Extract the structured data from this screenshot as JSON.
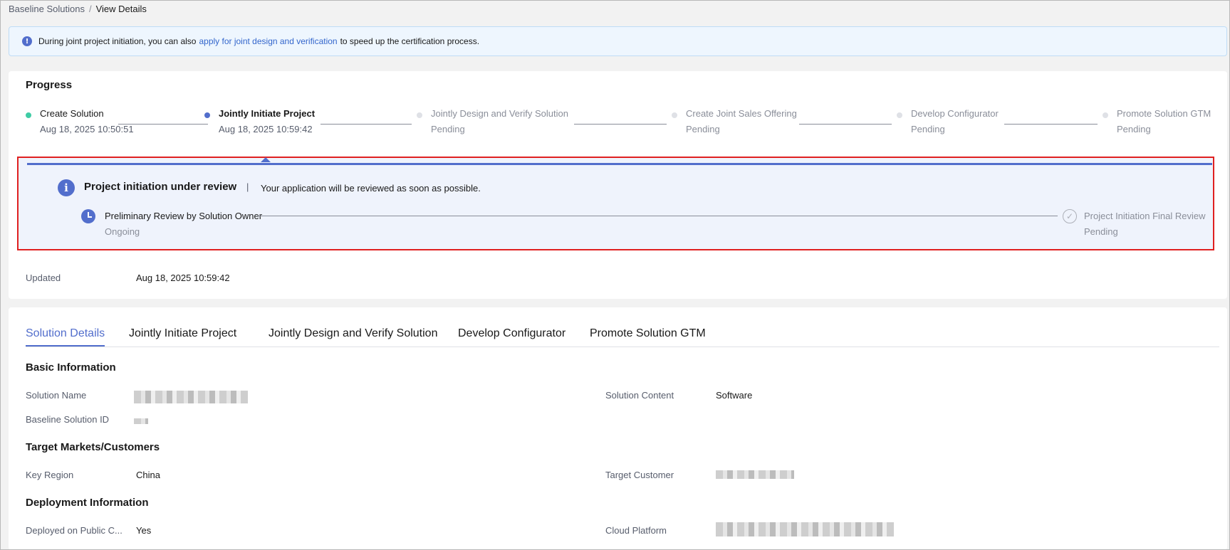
{
  "breadcrumb": {
    "parent": "Baseline Solutions",
    "separator": "/",
    "current": "View Details"
  },
  "notice": {
    "before": "During joint project initiation, you can also",
    "link": "apply for joint design and verification",
    "after": "to speed up the certification process."
  },
  "progress": {
    "title": "Progress",
    "steps": [
      {
        "label": "Create Solution",
        "sub": "Aug 18, 2025 10:50:51",
        "status": "done"
      },
      {
        "label": "Jointly Initiate Project",
        "sub": "Aug 18, 2025 10:59:42",
        "status": "active"
      },
      {
        "label": "Jointly Design and Verify Solution",
        "sub": "Pending",
        "status": "pending"
      },
      {
        "label": "Create Joint Sales Offering",
        "sub": "Pending",
        "status": "pending"
      },
      {
        "label": "Develop Configurator",
        "sub": "Pending",
        "status": "pending"
      },
      {
        "label": "Promote Solution GTM",
        "sub": "Pending",
        "status": "pending"
      }
    ],
    "review": {
      "title": "Project initiation under review",
      "separator": "|",
      "message": "Your application will be reviewed as soon as possible.",
      "sub_steps": [
        {
          "label": "Preliminary Review by Solution Owner",
          "status": "Ongoing"
        },
        {
          "label": "Project Initiation Final Review",
          "status": "Pending"
        }
      ]
    },
    "updated_label": "Updated",
    "updated_value": "Aug 18, 2025 10:59:42"
  },
  "tabs": [
    {
      "label": "Solution Details"
    },
    {
      "label": "Jointly Initiate Project"
    },
    {
      "label": "Jointly Design and Verify Solution"
    },
    {
      "label": "Develop Configurator"
    },
    {
      "label": "Promote Solution GTM"
    }
  ],
  "basic_info": {
    "title": "Basic Information",
    "solution_name_label": "Solution Name",
    "solution_content_label": "Solution Content",
    "solution_content_value": "Software",
    "baseline_id_label": "Baseline Solution ID"
  },
  "target": {
    "title": "Target Markets/Customers",
    "key_region_label": "Key Region",
    "key_region_value": "China",
    "target_customer_label": "Target Customer"
  },
  "deployment": {
    "title": "Deployment Information",
    "public_cloud_label": "Deployed on Public C...",
    "public_cloud_value": "Yes",
    "cloud_platform_label": "Cloud Platform"
  },
  "colors": {
    "accent": "#526ecc",
    "done": "#3fcca5",
    "pending": "#dfe1e6",
    "highlight_border": "#e02020",
    "notice_bg": "#eef6fe",
    "review_bg": "#eff3fc"
  }
}
